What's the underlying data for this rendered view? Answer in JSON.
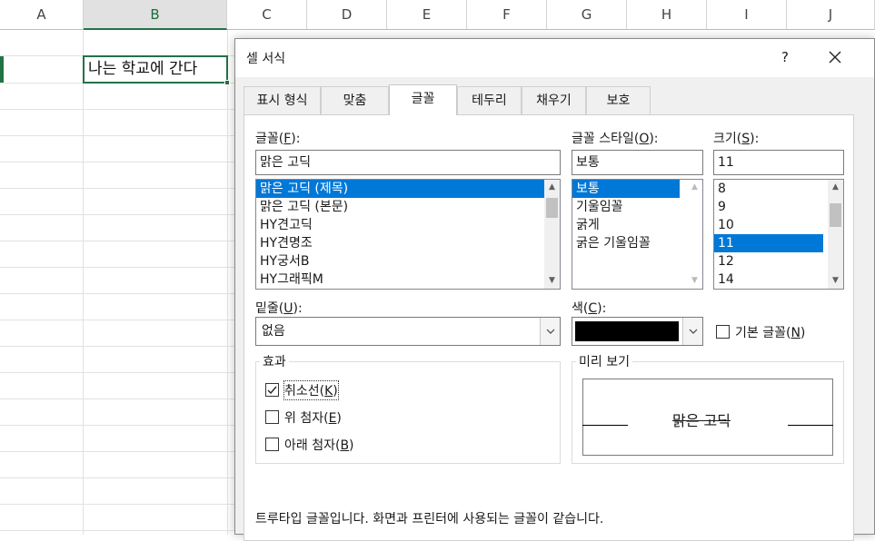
{
  "sheet": {
    "columns": [
      "A",
      "B",
      "C",
      "D",
      "E",
      "F",
      "G",
      "H",
      "I",
      "J"
    ],
    "active_cell_text": "나는 학교에 간다"
  },
  "dialog": {
    "title": "셀 서식",
    "help": "?",
    "close": "✕",
    "tabs": [
      "표시 형식",
      "맞춤",
      "글꼴",
      "테두리",
      "채우기",
      "보호"
    ],
    "active_tab": "글꼴",
    "font": {
      "label": "글꼴(",
      "accel": "F",
      "label_end": "):",
      "value": "맑은 고딕",
      "items": [
        "맑은 고딕 (제목)",
        "맑은 고딕 (본문)",
        "HY견고딕",
        "HY견명조",
        "HY궁서B",
        "HY그래픽M"
      ],
      "selected_index": 0
    },
    "style": {
      "label": "글꼴 스타일(",
      "accel": "O",
      "label_end": "):",
      "value": "보통",
      "items": [
        "보통",
        "기울임꼴",
        "굵게",
        "굵은 기울임꼴"
      ],
      "selected_index": 0
    },
    "size": {
      "label": "크기(",
      "accel": "S",
      "label_end": "):",
      "value": "11",
      "items": [
        "8",
        "9",
        "10",
        "11",
        "12",
        "14"
      ],
      "selected_index": 3
    },
    "underline": {
      "label": "밑줄(",
      "accel": "U",
      "label_end": "):",
      "value": "없음"
    },
    "color": {
      "label": "색(",
      "accel": "C",
      "label_end": "):",
      "value_color": "#000000"
    },
    "normal_font": {
      "label": "기본 글꼴(",
      "accel": "N",
      "label_end": ")",
      "checked": false
    },
    "effects": {
      "title": "효과",
      "strikethrough": {
        "label": "취소선(",
        "accel": "K",
        "label_end": ")",
        "checked": true
      },
      "superscript": {
        "label": "위 첨자(",
        "accel": "E",
        "label_end": ")",
        "checked": false
      },
      "subscript": {
        "label": "아래 첨자(",
        "accel": "B",
        "label_end": ")",
        "checked": false
      }
    },
    "preview": {
      "title": "미리 보기",
      "text": "맑은 고딕"
    },
    "footnote": "트루타입 글꼴입니다. 화면과 프린터에 사용되는 글꼴이 같습니다."
  },
  "colors": {
    "excel_green": "#217346",
    "selection_blue": "#0078d7"
  }
}
